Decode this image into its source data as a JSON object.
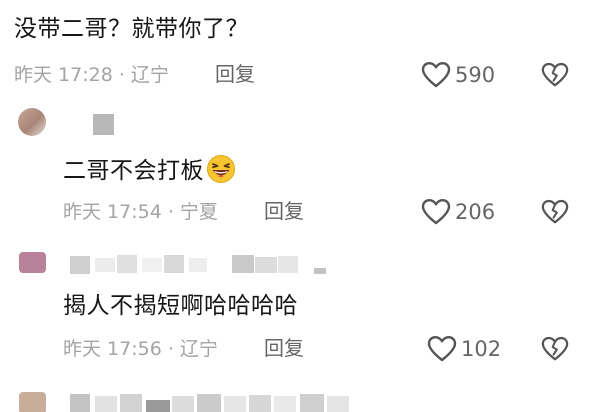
{
  "comments": [
    {
      "text": "没带二哥？就带你了？",
      "meta": "昨天 17:28 · 辽宁",
      "reply_label": "回复",
      "likes": "590"
    },
    {
      "text": "二哥不会打板",
      "meta": "昨天 17:54 · 宁夏",
      "reply_label": "回复",
      "likes": "206"
    },
    {
      "text": "揭人不揭短啊哈哈哈哈",
      "meta": "昨天 17:56 · 辽宁",
      "reply_label": "回复",
      "likes": "102"
    }
  ],
  "colors": {
    "text_primary": "#161616",
    "text_meta": "#a4a4a4",
    "text_action": "#666666"
  },
  "icons": [
    "heart-outline-icon",
    "broken-heart-icon",
    "laughing-emoji-icon"
  ]
}
